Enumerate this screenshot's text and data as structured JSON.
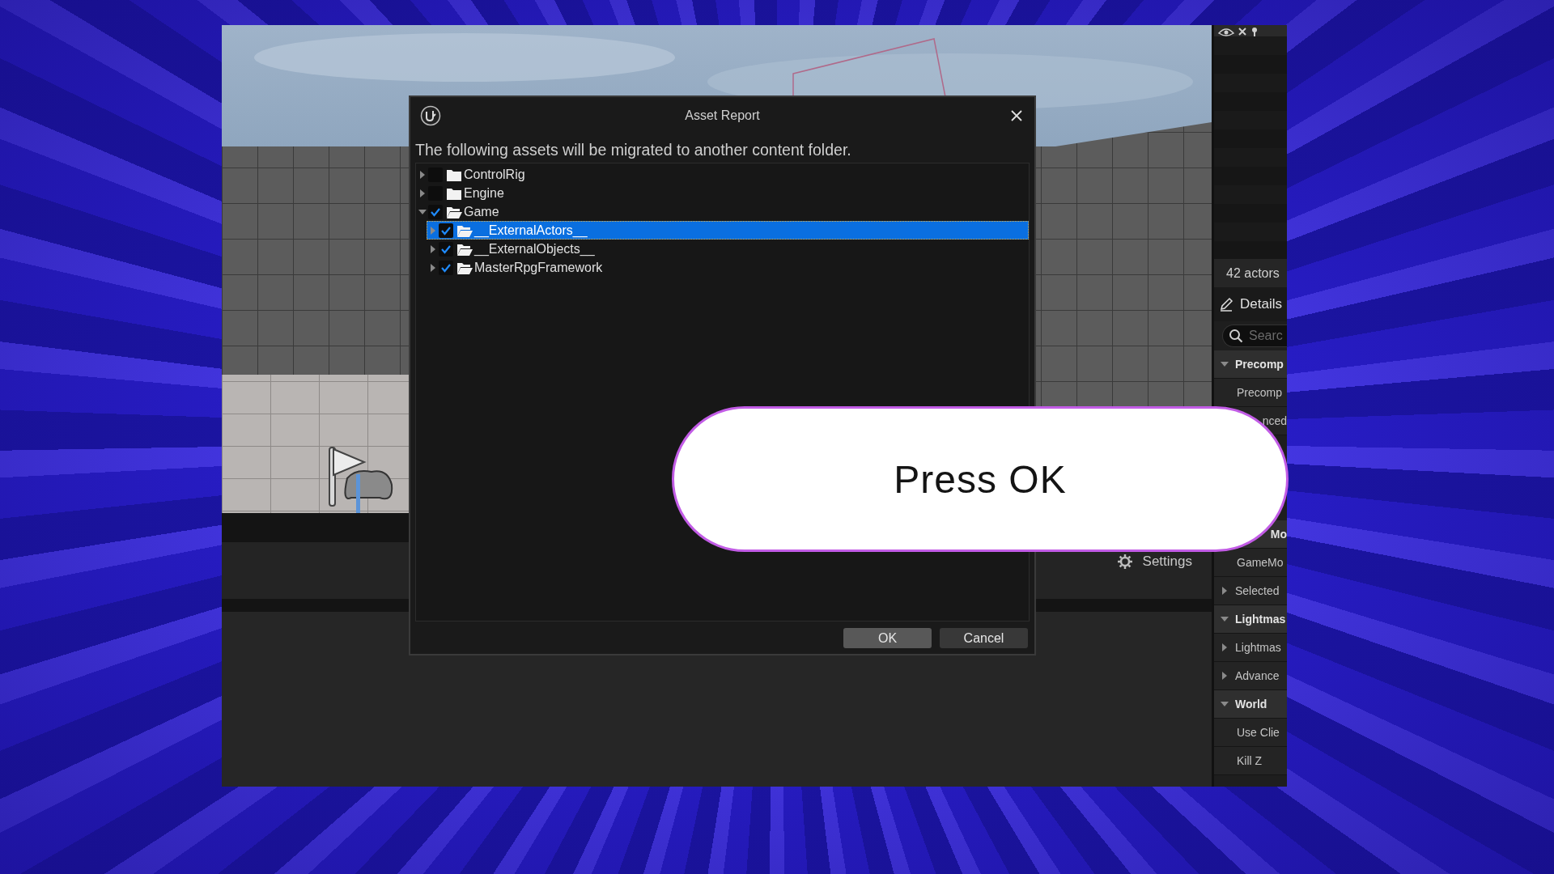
{
  "editor": {
    "outliner_footer": "42 actors",
    "details_tab": "Details",
    "search": {
      "placeholder": "Searc"
    },
    "details_rows_top": [
      {
        "kind": "header",
        "label": "Precomp",
        "expanded": true
      },
      {
        "kind": "item",
        "label": "Precomp"
      },
      {
        "kind": "partial",
        "label": "nced"
      }
    ],
    "details_rows_bottom": [
      {
        "kind": "partial-header",
        "label": "Mo"
      },
      {
        "kind": "item",
        "label": "GameMo"
      },
      {
        "kind": "group",
        "label": "Selected",
        "expanded": false
      },
      {
        "kind": "header",
        "label": "Lightmas",
        "expanded": true
      },
      {
        "kind": "group",
        "label": "Lightmas",
        "expanded": false
      },
      {
        "kind": "group",
        "label": "Advance",
        "expanded": false
      },
      {
        "kind": "header",
        "label": "World",
        "expanded": true
      },
      {
        "kind": "item",
        "label": "Use Clie"
      },
      {
        "kind": "item",
        "label": "Kill Z"
      }
    ],
    "settings_button": "Settings"
  },
  "dialog": {
    "title": "Asset Report",
    "message": "The following assets will be migrated to another content folder.",
    "tree": [
      {
        "label": "ControlRig",
        "checked": false,
        "expanded": false,
        "selected": false,
        "kind": "folder"
      },
      {
        "label": "Engine",
        "checked": false,
        "expanded": false,
        "selected": false,
        "kind": "folder"
      },
      {
        "label": "Game",
        "checked": true,
        "expanded": true,
        "selected": false,
        "kind": "open-folder",
        "children": [
          {
            "label": "__ExternalActors__",
            "checked": true,
            "expanded": false,
            "selected": true,
            "kind": "open-folder"
          },
          {
            "label": "__ExternalObjects__",
            "checked": true,
            "expanded": false,
            "selected": false,
            "kind": "open-folder"
          },
          {
            "label": "MasterRpgFramework",
            "checked": true,
            "expanded": false,
            "selected": false,
            "kind": "open-folder"
          }
        ]
      }
    ],
    "buttons": [
      {
        "label": "OK",
        "kind": "primary"
      },
      {
        "label": "Cancel",
        "kind": "secondary"
      }
    ]
  },
  "callout": {
    "text": "Press OK"
  }
}
